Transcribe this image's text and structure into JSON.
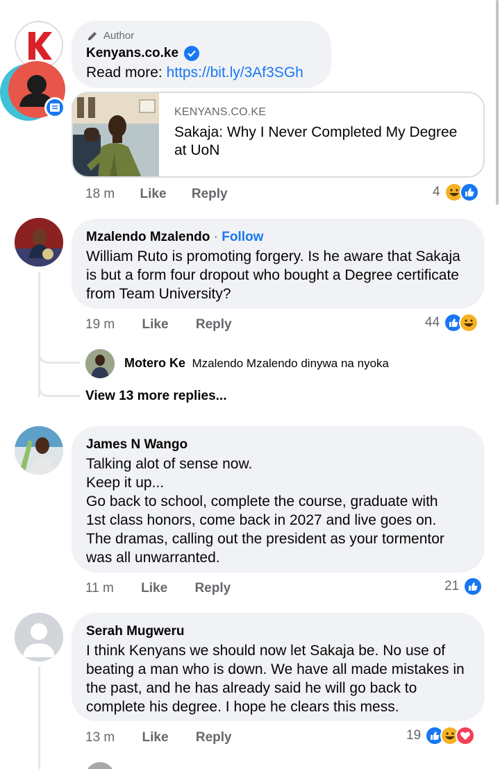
{
  "comments": [
    {
      "badge": "Author",
      "name": "Kenyans.co.ke",
      "read_more_label": "Read more: ",
      "link": "https://bit.ly/3Af3SGh",
      "preview": {
        "domain": "KENYANS.CO.KE",
        "title": "Sakaja: Why I Never Completed My Degree at UoN"
      },
      "time": "18 m",
      "like": "Like",
      "reply": "Reply",
      "reaction_count": "4",
      "reactions": [
        "haha",
        "like"
      ]
    },
    {
      "name": "Mzalendo Mzalendo",
      "follow_sep": " · ",
      "follow": "Follow",
      "text": "William Ruto is promoting forgery. Is he aware that Sakaja is but a form four dropout who bought a Degree certificate from Team University?",
      "time": "19 m",
      "like": "Like",
      "reply": "Reply",
      "reaction_count": "44",
      "reactions": [
        "like",
        "haha"
      ],
      "reply_preview": {
        "name": "Motero Ke",
        "text": "Mzalendo Mzalendo dinywa na nyoka"
      },
      "view_more": "View 13 more replies..."
    },
    {
      "name": "James N Wango",
      "lines": [
        "Talking alot of sense now.",
        "Keep it up...",
        "Go back to school, complete the course, graduate with 1st class honors, come back in 2027 and live goes on. The dramas, calling out the president as your tormentor was all unwarranted."
      ],
      "time": "11 m",
      "like": "Like",
      "reply": "Reply",
      "reaction_count": "21",
      "reactions": [
        "like"
      ]
    },
    {
      "name": "Serah Mugweru",
      "text": "I think Kenyans we should now let Sakaja be. No use of beating a man who is down. We have all made mistakes in the past, and he has already said he will go back to complete his degree. I hope he clears this mess.",
      "time": "13 m",
      "like": "Like",
      "reply": "Reply",
      "reaction_count": "19",
      "reactions": [
        "like",
        "haha",
        "love"
      ]
    }
  ],
  "colors": {
    "link": "#1877f2",
    "bubble": "#f0f2f5",
    "muted": "#65676b",
    "verified": "#1877f2"
  }
}
